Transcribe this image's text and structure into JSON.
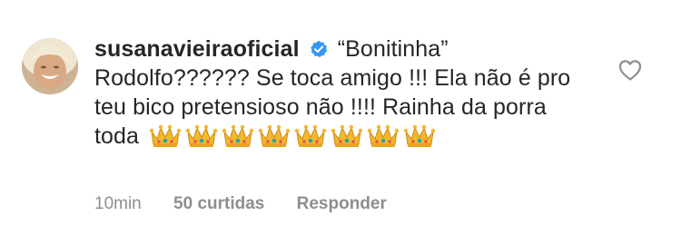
{
  "comment": {
    "username": "susanavieiraoficial",
    "verified": true,
    "text": "“Bonitinha” Rodolfo?????? Se toca amigo !!! Ela não é pro teu bico pretensioso não !!!! Rainha da porra toda",
    "emoji_name": "crown",
    "emoji_count": 8,
    "time": "10min",
    "likes": "50 curtidas",
    "reply_label": "Responder"
  },
  "icons": {
    "avatar": "avatar",
    "verified": "verified-badge-icon",
    "like": "heart-outline-icon"
  },
  "colors": {
    "text": "#262626",
    "meta": "#8e8e8e",
    "verified_blue": "#3897f0",
    "crown_gold": "#f5b72b"
  }
}
